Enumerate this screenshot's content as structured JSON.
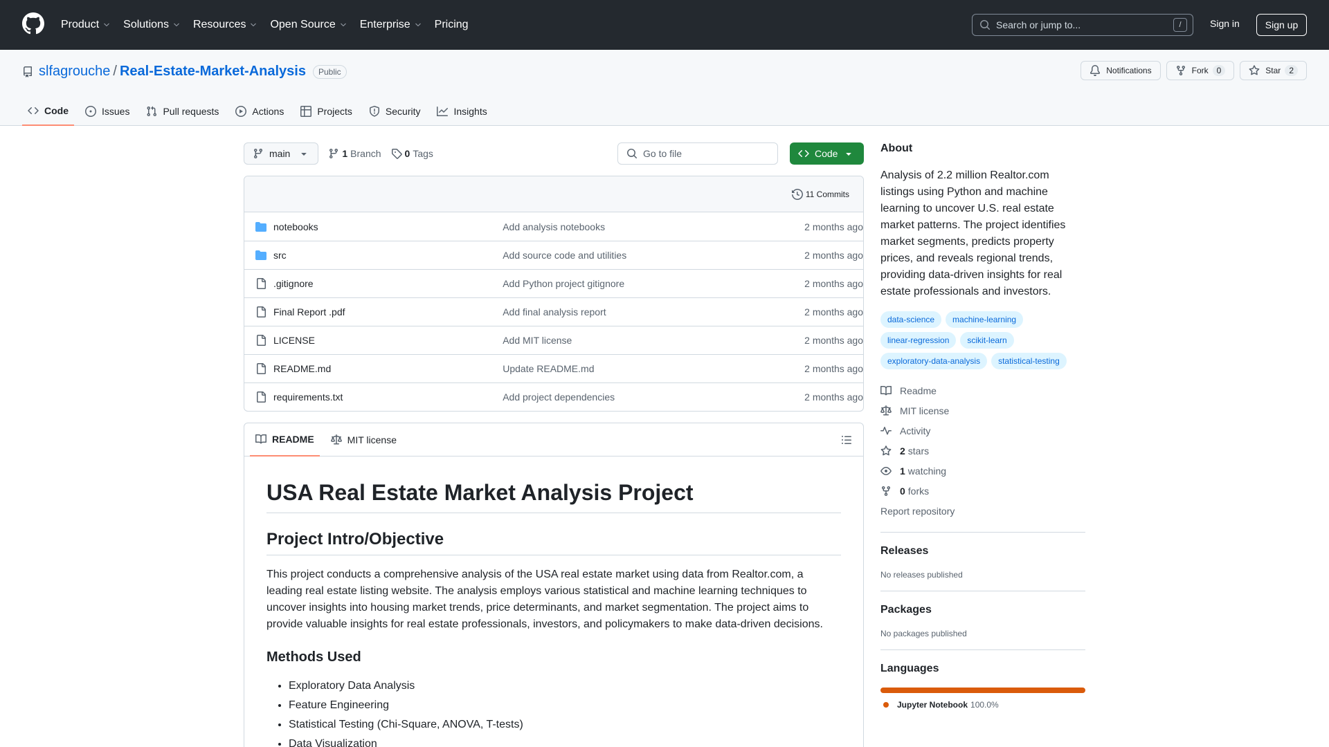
{
  "header": {
    "nav": [
      "Product",
      "Solutions",
      "Resources",
      "Open Source",
      "Enterprise",
      "Pricing"
    ],
    "search_placeholder": "Search or jump to...",
    "search_key": "/",
    "sign_in": "Sign in",
    "sign_up": "Sign up"
  },
  "repo": {
    "owner": "slfagrouche",
    "separator": "/",
    "name": "Real-Estate-Market-Analysis",
    "visibility": "Public",
    "notifications": "Notifications",
    "fork_label": "Fork",
    "fork_count": "0",
    "star_label": "Star",
    "star_count": "2",
    "tabs": [
      "Code",
      "Issues",
      "Pull requests",
      "Actions",
      "Projects",
      "Security",
      "Insights"
    ]
  },
  "toolbar": {
    "branch": "main",
    "branch_count": "1",
    "branch_label": "Branch",
    "tag_count": "0",
    "tag_label": "Tags",
    "goto_placeholder": "Go to file",
    "code_button": "Code"
  },
  "files": {
    "commits": "11 Commits",
    "rows": [
      {
        "name": "notebooks",
        "type": "folder",
        "message": "Add analysis notebooks",
        "age": "2 months ago"
      },
      {
        "name": "src",
        "type": "folder",
        "message": "Add source code and utilities",
        "age": "2 months ago"
      },
      {
        "name": ".gitignore",
        "type": "file",
        "message": "Add Python project gitignore",
        "age": "2 months ago"
      },
      {
        "name": "Final Report .pdf",
        "type": "file",
        "message": "Add final analysis report",
        "age": "2 months ago"
      },
      {
        "name": "LICENSE",
        "type": "file",
        "message": "Add MIT license",
        "age": "2 months ago"
      },
      {
        "name": "README.md",
        "type": "file",
        "message": "Update README.md",
        "age": "2 months ago"
      },
      {
        "name": "requirements.txt",
        "type": "file",
        "message": "Add project dependencies",
        "age": "2 months ago"
      }
    ]
  },
  "readme": {
    "tab_readme": "README",
    "tab_license": "MIT license",
    "h1": "USA Real Estate Market Analysis Project",
    "h2": "Project Intro/Objective",
    "intro": "This project conducts a comprehensive analysis of the USA real estate market using data from Realtor.com, a leading real estate listing website. The analysis employs various statistical and machine learning techniques to uncover insights into housing market trends, price determinants, and market segmentation. The project aims to provide valuable insights for real estate professionals, investors, and policymakers to make data-driven decisions.",
    "h3": "Methods Used",
    "methods": [
      "Exploratory Data Analysis",
      "Feature Engineering",
      "Statistical Testing (Chi-Square, ANOVA, T-tests)",
      "Data Visualization"
    ]
  },
  "sidebar": {
    "about_title": "About",
    "about_text": "Analysis of 2.2 million Realtor.com listings using Python and machine learning to uncover U.S. real estate market patterns. The project identifies market segments, predicts property prices, and reveals regional trends, providing data-driven insights for real estate professionals and investors.",
    "topics": [
      "data-science",
      "machine-learning",
      "linear-regression",
      "scikit-learn",
      "exploratory-data-analysis",
      "statistical-testing"
    ],
    "readme": "Readme",
    "license": "MIT license",
    "activity": "Activity",
    "stars_count": "2",
    "stars_label": "stars",
    "watching_count": "1",
    "watching_label": "watching",
    "forks_count": "0",
    "forks_label": "forks",
    "report": "Report repository",
    "releases_title": "Releases",
    "releases_text": "No releases published",
    "packages_title": "Packages",
    "packages_text": "No packages published",
    "languages_title": "Languages",
    "language_name": "Jupyter Notebook",
    "language_pct": "100.0%",
    "language_share": 1.0,
    "language_color": "#da5b0b"
  }
}
